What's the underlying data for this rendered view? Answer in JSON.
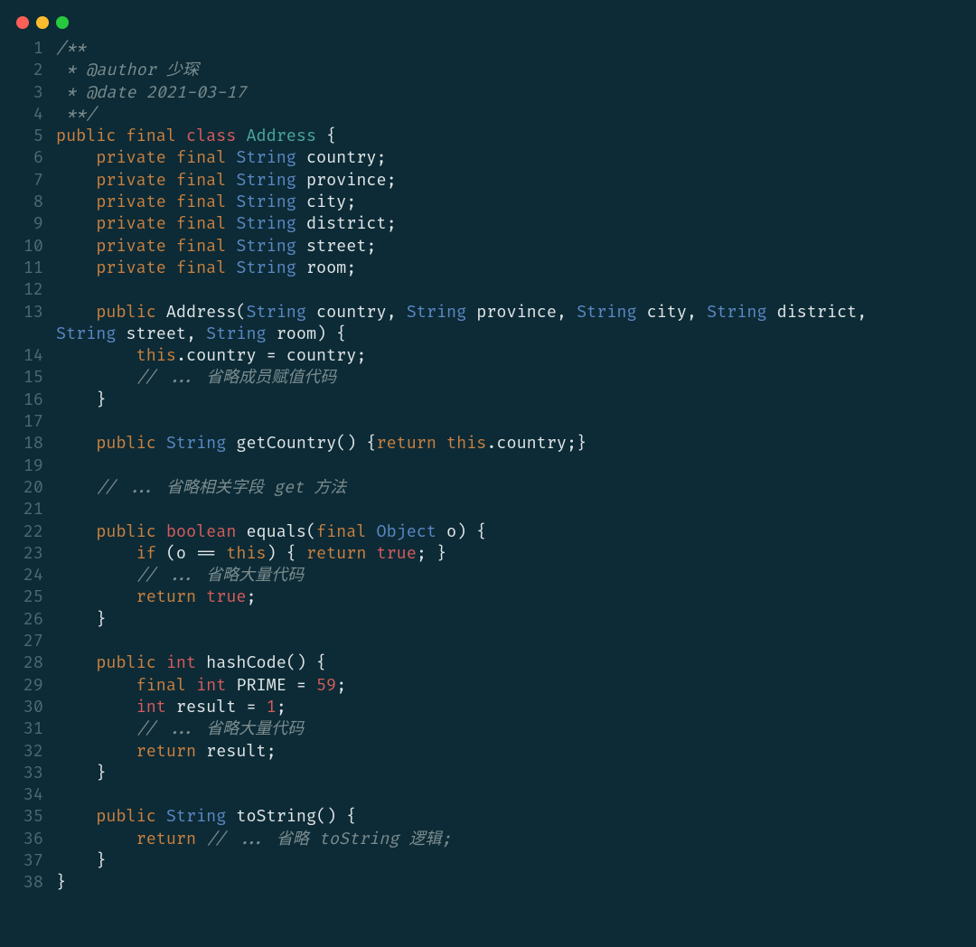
{
  "colors": {
    "background": "#0d2b36",
    "dot_red": "#ff5f56",
    "dot_yellow": "#ffbd2e",
    "dot_green": "#27c93f"
  },
  "code": {
    "lines": [
      {
        "n": 1,
        "t": [
          [
            "comment",
            "/**"
          ]
        ]
      },
      {
        "n": 2,
        "t": [
          [
            "comment",
            " * @author 少琛"
          ]
        ]
      },
      {
        "n": 3,
        "t": [
          [
            "comment",
            " * @date 2021-03-17"
          ]
        ]
      },
      {
        "n": 4,
        "t": [
          [
            "comment",
            " **/"
          ]
        ]
      },
      {
        "n": 5,
        "t": [
          [
            "key1",
            "public "
          ],
          [
            "key1",
            "final "
          ],
          [
            "key2",
            "class "
          ],
          [
            "classname",
            "Address "
          ],
          [
            "text",
            "{"
          ]
        ]
      },
      {
        "n": 6,
        "t": [
          [
            "text",
            "    "
          ],
          [
            "key1",
            "private "
          ],
          [
            "key1",
            "final "
          ],
          [
            "type",
            "String "
          ],
          [
            "text",
            "country;"
          ]
        ]
      },
      {
        "n": 7,
        "t": [
          [
            "text",
            "    "
          ],
          [
            "key1",
            "private "
          ],
          [
            "key1",
            "final "
          ],
          [
            "type",
            "String "
          ],
          [
            "text",
            "province;"
          ]
        ]
      },
      {
        "n": 8,
        "t": [
          [
            "text",
            "    "
          ],
          [
            "key1",
            "private "
          ],
          [
            "key1",
            "final "
          ],
          [
            "type",
            "String "
          ],
          [
            "text",
            "city;"
          ]
        ]
      },
      {
        "n": 9,
        "t": [
          [
            "text",
            "    "
          ],
          [
            "key1",
            "private "
          ],
          [
            "key1",
            "final "
          ],
          [
            "type",
            "String "
          ],
          [
            "text",
            "district;"
          ]
        ]
      },
      {
        "n": 10,
        "t": [
          [
            "text",
            "    "
          ],
          [
            "key1",
            "private "
          ],
          [
            "key1",
            "final "
          ],
          [
            "type",
            "String "
          ],
          [
            "text",
            "street;"
          ]
        ]
      },
      {
        "n": 11,
        "t": [
          [
            "text",
            "    "
          ],
          [
            "key1",
            "private "
          ],
          [
            "key1",
            "final "
          ],
          [
            "type",
            "String "
          ],
          [
            "text",
            "room;"
          ]
        ]
      },
      {
        "n": 12,
        "t": []
      },
      {
        "n": 13,
        "t": [
          [
            "text",
            "    "
          ],
          [
            "key1",
            "public"
          ],
          [
            "text",
            " Address("
          ],
          [
            "type",
            "String"
          ],
          [
            "text",
            " country, "
          ],
          [
            "type",
            "String"
          ],
          [
            "text",
            " province, "
          ],
          [
            "type",
            "String"
          ],
          [
            "text",
            " city, "
          ],
          [
            "type",
            "String"
          ],
          [
            "text",
            " district, "
          ]
        ],
        "cont": [
          [
            "type",
            "String"
          ],
          [
            "text",
            " street, "
          ],
          [
            "type",
            "String"
          ],
          [
            "text",
            " room) {"
          ]
        ]
      },
      {
        "n": 14,
        "t": [
          [
            "text",
            "        "
          ],
          [
            "key1",
            "this"
          ],
          [
            "text",
            ".country = country;"
          ]
        ]
      },
      {
        "n": 15,
        "t": [
          [
            "text",
            "        "
          ],
          [
            "comment",
            "// ... 省略成员赋值代码"
          ]
        ]
      },
      {
        "n": 16,
        "t": [
          [
            "text",
            "    }"
          ]
        ]
      },
      {
        "n": 17,
        "t": []
      },
      {
        "n": 18,
        "t": [
          [
            "text",
            "    "
          ],
          [
            "key1",
            "public "
          ],
          [
            "type",
            "String "
          ],
          [
            "text",
            "getCountry() {"
          ],
          [
            "key1",
            "return "
          ],
          [
            "key1",
            "this"
          ],
          [
            "text",
            ".country;}"
          ]
        ]
      },
      {
        "n": 19,
        "t": []
      },
      {
        "n": 20,
        "t": [
          [
            "text",
            "    "
          ],
          [
            "comment",
            "// ... 省略相关字段 get 方法"
          ]
        ]
      },
      {
        "n": 21,
        "t": []
      },
      {
        "n": 22,
        "t": [
          [
            "text",
            "    "
          ],
          [
            "key1",
            "public "
          ],
          [
            "key2",
            "boolean "
          ],
          [
            "text",
            "equals("
          ],
          [
            "key1",
            "final "
          ],
          [
            "type",
            "Object "
          ],
          [
            "text",
            "o) {"
          ]
        ]
      },
      {
        "n": 23,
        "t": [
          [
            "text",
            "        "
          ],
          [
            "key1",
            "if"
          ],
          [
            "text",
            " (o == "
          ],
          [
            "key1",
            "this"
          ],
          [
            "text",
            ") { "
          ],
          [
            "key1",
            "return "
          ],
          [
            "num",
            "true"
          ],
          [
            "text",
            "; }"
          ]
        ]
      },
      {
        "n": 24,
        "t": [
          [
            "text",
            "        "
          ],
          [
            "comment",
            "// ... 省略大量代码"
          ]
        ]
      },
      {
        "n": 25,
        "t": [
          [
            "text",
            "        "
          ],
          [
            "key1",
            "return "
          ],
          [
            "num",
            "true"
          ],
          [
            "text",
            ";"
          ]
        ]
      },
      {
        "n": 26,
        "t": [
          [
            "text",
            "    }"
          ]
        ]
      },
      {
        "n": 27,
        "t": []
      },
      {
        "n": 28,
        "t": [
          [
            "text",
            "    "
          ],
          [
            "key1",
            "public "
          ],
          [
            "key2",
            "int"
          ],
          [
            "text",
            " hashCode() {"
          ]
        ]
      },
      {
        "n": 29,
        "t": [
          [
            "text",
            "        "
          ],
          [
            "key1",
            "final "
          ],
          [
            "key2",
            "int"
          ],
          [
            "text",
            " PRIME = "
          ],
          [
            "num",
            "59"
          ],
          [
            "text",
            ";"
          ]
        ]
      },
      {
        "n": 30,
        "t": [
          [
            "text",
            "        "
          ],
          [
            "key2",
            "int"
          ],
          [
            "text",
            " result = "
          ],
          [
            "num",
            "1"
          ],
          [
            "text",
            ";"
          ]
        ]
      },
      {
        "n": 31,
        "t": [
          [
            "text",
            "        "
          ],
          [
            "comment",
            "// ... 省略大量代码"
          ]
        ]
      },
      {
        "n": 32,
        "t": [
          [
            "text",
            "        "
          ],
          [
            "key1",
            "return"
          ],
          [
            "text",
            " result;"
          ]
        ]
      },
      {
        "n": 33,
        "t": [
          [
            "text",
            "    }"
          ]
        ]
      },
      {
        "n": 34,
        "t": []
      },
      {
        "n": 35,
        "t": [
          [
            "text",
            "    "
          ],
          [
            "key1",
            "public "
          ],
          [
            "type",
            "String "
          ],
          [
            "text",
            "toString() {"
          ]
        ]
      },
      {
        "n": 36,
        "t": [
          [
            "text",
            "        "
          ],
          [
            "key1",
            "return "
          ],
          [
            "comment",
            "// ... 省略 toString 逻辑;"
          ]
        ]
      },
      {
        "n": 37,
        "t": [
          [
            "text",
            "    }"
          ]
        ]
      },
      {
        "n": 38,
        "t": [
          [
            "text",
            "}"
          ]
        ]
      }
    ]
  }
}
